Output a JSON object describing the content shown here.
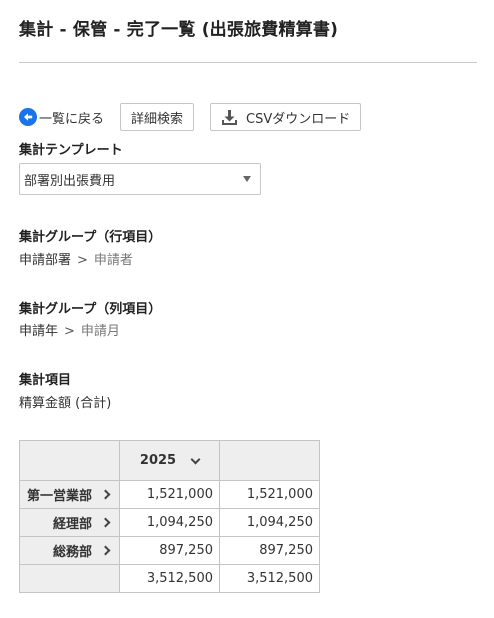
{
  "page": {
    "title": "集計 - 保管 - 完了一覧 (出張旅費精算書)"
  },
  "toolbar": {
    "back_label": "一覧に戻る",
    "search_label": "詳細検索",
    "csv_label": "CSVダウンロード"
  },
  "template": {
    "label": "集計テンプレート",
    "selected": "部署別出張費用"
  },
  "row_group": {
    "label": "集計グループ（行項目）",
    "first": "申請部署",
    "separator": ">",
    "second": "申請者"
  },
  "col_group": {
    "label": "集計グループ（列項目）",
    "first": "申請年",
    "separator": ">",
    "second": "申請月"
  },
  "item": {
    "label": "集計項目",
    "value": "精算金額 (合計)"
  },
  "table": {
    "column_header": "2025",
    "rows": [
      {
        "label": "第一営業部",
        "v1": "1,521,000",
        "v2": "1,521,000"
      },
      {
        "label": "経理部",
        "v1": "1,094,250",
        "v2": "1,094,250"
      },
      {
        "label": "総務部",
        "v1": "897,250",
        "v2": "897,250"
      }
    ],
    "total": {
      "v1": "3,512,500",
      "v2": "3,512,500"
    }
  },
  "colors": {
    "header_background": "#eeeeee",
    "back_icon": "#1a73e8",
    "border": "#c4c4c4"
  },
  "icons": {
    "back": "arrow-left-circle-icon",
    "csv": "download-icon",
    "select": "caret-down-icon",
    "row_expand": "chevron-right-icon",
    "col_expand": "chevron-down-icon"
  }
}
